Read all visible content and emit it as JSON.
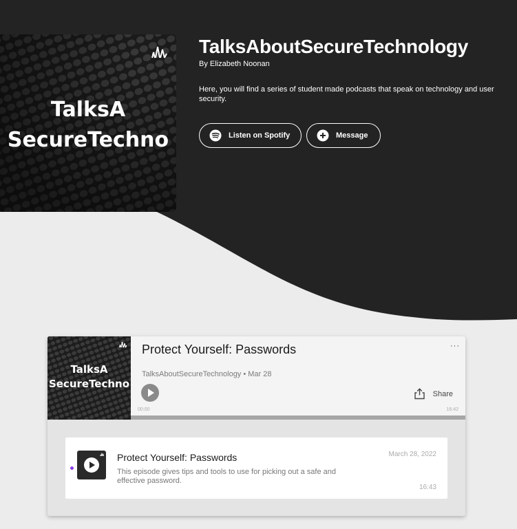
{
  "colors": {
    "header_bg": "#232323",
    "page_bg": "#ececec",
    "accent_dot": "#8c3ee6"
  },
  "podcast": {
    "title": "TalksAboutSecureTechnology",
    "author": "By Elizabeth Noonan",
    "description": "Here, you will find a series of student made podcasts that speak on technology and user security.",
    "cover_text_line1": "TalksA",
    "cover_text_line2": "SecureTechno",
    "cover_logo_icon": "anchor-logo-icon"
  },
  "actions": {
    "spotify_label": "Listen on Spotify",
    "spotify_icon": "spotify-icon",
    "message_label": "Message",
    "message_icon": "plus-circle-icon"
  },
  "player": {
    "episode_title": "Protect Yourself: Passwords",
    "meta": "TalksAboutSecureTechnology • Mar 28",
    "more_label": "···",
    "share_label": "Share",
    "time_elapsed": "00:00",
    "time_total": "16:42",
    "progress": 0
  },
  "episodes": [
    {
      "title": "Protect Yourself: Passwords",
      "description": "This episode gives tips and tools to use for picking out a safe and effective password.",
      "date": "March 28, 2022",
      "duration": "16:43"
    }
  ]
}
